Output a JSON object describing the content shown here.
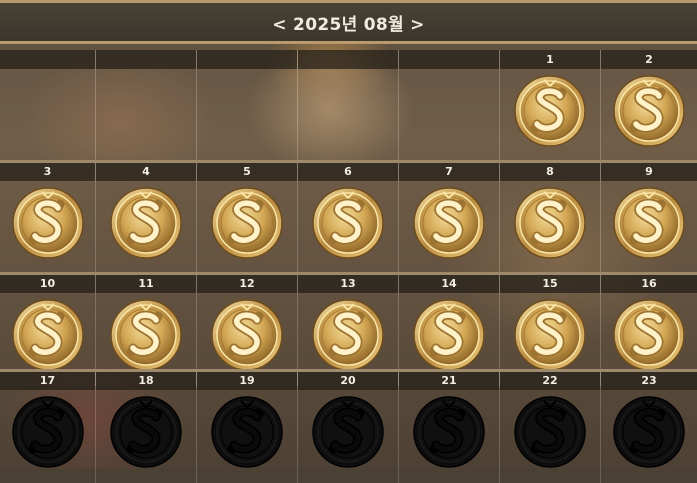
{
  "calendar": {
    "title": "< 2025년 08월 >",
    "weeks": [
      [
        "",
        "",
        "",
        "",
        "",
        "1",
        "2"
      ],
      [
        "3",
        "4",
        "5",
        "6",
        "7",
        "8",
        "9"
      ],
      [
        "10",
        "11",
        "12",
        "13",
        "14",
        "15",
        "16"
      ],
      [
        "17",
        "18",
        "19",
        "20",
        "21",
        "22",
        "23"
      ]
    ],
    "claimed_days": [
      "1",
      "2",
      "3",
      "4",
      "5",
      "6",
      "7",
      "8",
      "9",
      "10",
      "11",
      "12",
      "13",
      "14",
      "15",
      "16"
    ],
    "unclaimed_days": [
      "17",
      "18",
      "19",
      "20",
      "21",
      "22",
      "23"
    ],
    "coin_icon": "s-coin-icon"
  },
  "colors": {
    "header_border": "#b99a6c",
    "coin_gold": "#d9b15a",
    "coin_dark": "#111111"
  }
}
